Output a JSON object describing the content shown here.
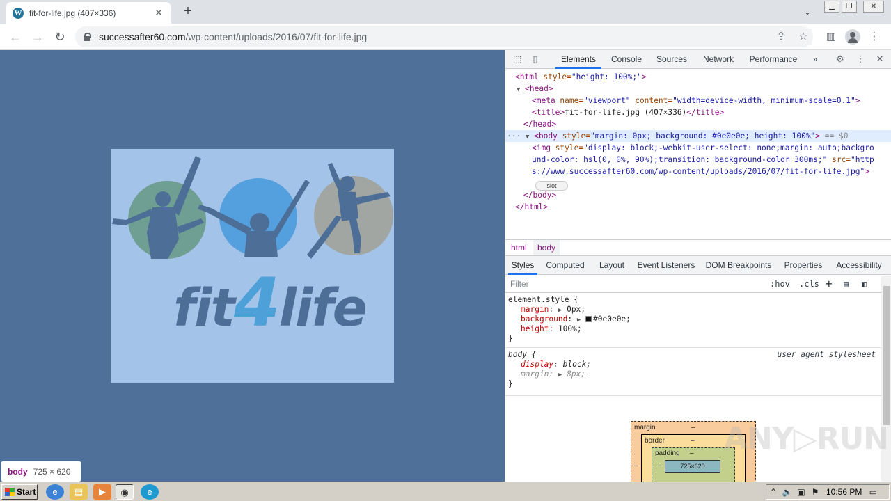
{
  "browser": {
    "tab_title": "fit-for-life.jpg (407×336)",
    "favicon_letter": "W",
    "new_tab": "+",
    "url_domain": "successafter60.com",
    "url_path": "/wp-content/uploads/2016/07/fit-for-life.jpg"
  },
  "page": {
    "background_color": "#4f7199",
    "image_background": "#a3c3e8",
    "logo_fit": "fit",
    "logo_four": "4",
    "logo_life": "life",
    "tooltip_tag": "body",
    "tooltip_dims": "725 × 620"
  },
  "devtools": {
    "tabs": [
      "Elements",
      "Console",
      "Sources",
      "Network",
      "Performance"
    ],
    "more_tabs": "»",
    "dom": {
      "html_open_tag": "<html",
      "html_open_attr": " style=",
      "html_open_val": "\"height: 100%;\"",
      "html_open_end": ">",
      "head_open": "<head>",
      "meta_tag": "<meta",
      "meta_name_attr": " name=",
      "meta_name_val": "\"viewport\"",
      "meta_content_attr": " content=",
      "meta_content_val": "\"width=device-width, minimum-scale=0.1\"",
      "meta_end": ">",
      "title_open": "<title>",
      "title_text": "fit-for-life.jpg (407×336)",
      "title_close": "</title>",
      "head_close": "</head>",
      "body_prefix": "···",
      "body_tag": "<body",
      "body_attr": " style=",
      "body_val": "\"margin: 0px; background: #0e0e0e; height: 100%\"",
      "body_end": ">",
      "body_eq": " == $0",
      "img_tag": "<img",
      "img_attr": " style=",
      "img_val_1": "\"display: block;-webkit-user-select: none;margin: auto;backgro",
      "img_val_2": "und-color: hsl(0, 0%, 90%);transition: background-color 300ms;\"",
      "img_src_attr": " src=",
      "img_src_1": "\"http",
      "img_src_2": "s://www.successafter60.com/wp-content/uploads/2016/07/fit-for-life.jpg",
      "img_src_end": "\"",
      "img_end": ">",
      "slot": "slot",
      "body_close": "</body>",
      "html_close": "</html>"
    },
    "breadcrumbs": [
      "html",
      "body"
    ],
    "subtabs": [
      "Styles",
      "Computed",
      "Layout",
      "Event Listeners",
      "DOM Breakpoints",
      "Properties",
      "Accessibility"
    ],
    "filter_placeholder": "Filter",
    "filter_buttons": {
      "hov": ":hov",
      "cls": ".cls",
      "plus": "+"
    },
    "rules": {
      "element_selector": "element.style {",
      "margin_name": "margin",
      "margin_value": "0px;",
      "background_name": "background",
      "background_value": "#0e0e0e;",
      "height_name": "height",
      "height_value": "100%;",
      "close": "}",
      "body_selector": "body {",
      "ua_label": "user agent stylesheet",
      "display_name": "display",
      "display_value": "block;",
      "margin2_name": "margin",
      "margin2_value": "8px;"
    },
    "box_model": {
      "margin_label": "margin",
      "border_label": "border",
      "padding_label": "padding",
      "content_dims": "725×620",
      "dash": "–"
    }
  },
  "watermark": "ANY▷RUN",
  "taskbar": {
    "start_label": "Start",
    "clock": "10:56 PM"
  }
}
